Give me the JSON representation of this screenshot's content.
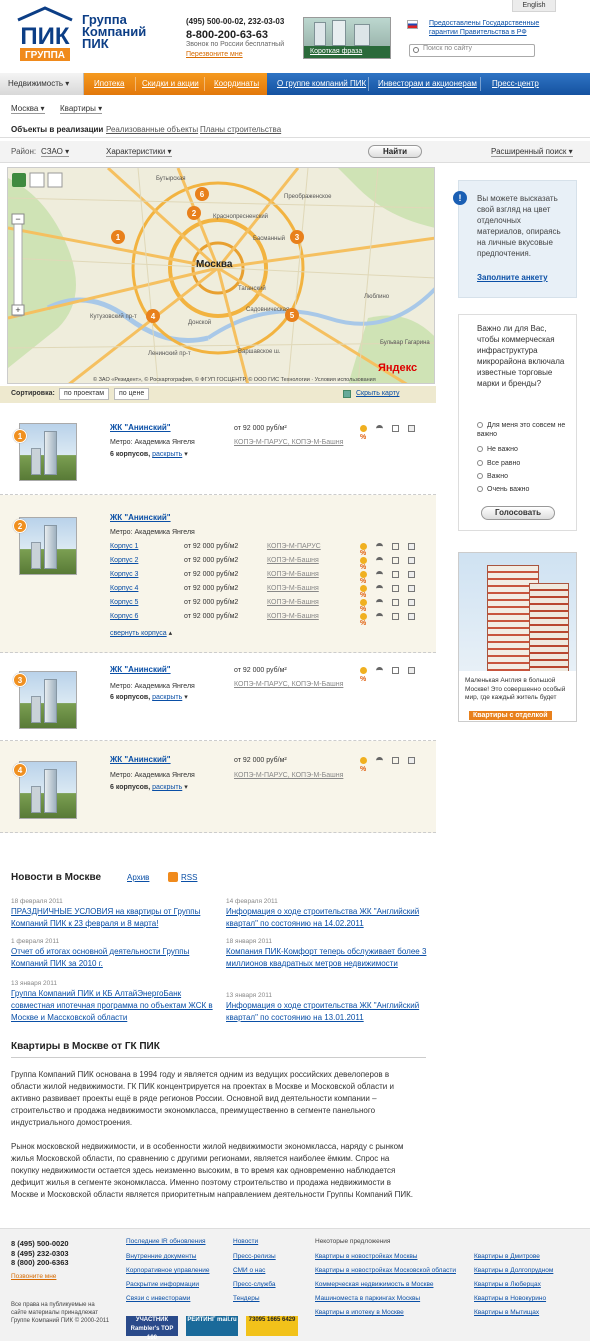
{
  "header": {
    "lang": "English",
    "logo_top": "ПИК",
    "logo_bottom": "ГРУППА",
    "brand": [
      "Группа",
      "Компаний",
      "ПИК"
    ],
    "phone_line": "(495) 500-00-02, 232-03-03",
    "phone_free": "8-800-200-63-63",
    "phone_free_note": "Звонок по России бесплатный",
    "callback": "Перезвоните мне",
    "promo_label": "Короткая фраза",
    "gos_link": "Предоставлены Государственные гарантии Правительства в РФ",
    "search_placeholder": "Поиск по сайту"
  },
  "nav": {
    "realty": "Недвижимость",
    "mortgage": "Ипотека",
    "discounts": "Скидки и акции",
    "coords": "Координаты",
    "about": "О группе компаний ПИК",
    "investors": "Инвесторам и акционерам",
    "press": "Пресс-центр"
  },
  "subnav": {
    "city": "Москва",
    "type": "Квартиры",
    "tab1": "Объекты в реализации",
    "tab2": "Реализованные объекты",
    "tab3": "Планы строительства",
    "district_label": "Район:",
    "district": "СЗАО",
    "characteristics": "Характеристики",
    "find": "Найти",
    "advanced": "Расширенный поиск"
  },
  "map": {
    "city_label": "Москва",
    "markers": [
      "1",
      "2",
      "3",
      "4",
      "5",
      "6"
    ],
    "copyright": "© ЗАО «Резидент», © Роскартография, © ФГУП ГОСЦЕНТР, © ООО ГИС Технологии · Условия использования",
    "yandex": "Яндекс",
    "streets": [
      "Бутырская",
      "Преображенское",
      "Краснопресненский",
      "Басманный",
      "Таганский",
      "Донской",
      "Люблино",
      "Бульвар Гагарина",
      "Садовническая",
      "Кутузовский пр-т",
      "Ленинский пр-т",
      "Варшавское ш."
    ]
  },
  "sortbar": {
    "label": "Сортировка:",
    "by_project": "по проектам",
    "by_price": "по цене",
    "hide_map": "Скрыть карту"
  },
  "objects": [
    {
      "num": "1",
      "title": "ЖК \"Анинский\"",
      "metro": "Метро: Академика Янгеля",
      "korpus": "6 корпусов,",
      "expand": "раскрыть",
      "price": "от 92 000 руб/м²",
      "dev": "КОПЭ-М-ПАРУС, КОПЭ-М-Башня"
    },
    {
      "num": "2",
      "title": "ЖК \"Анинский\"",
      "metro": "Метро: Академика Янгеля",
      "collapse": "свернуть корпуса",
      "rows": [
        {
          "name": "Корпус 1",
          "price": "от 92 000 руб/м2",
          "dev": "КОПЭ-М-ПАРУС"
        },
        {
          "name": "Корпус 2",
          "price": "от 92 000 руб/м2",
          "dev": "КОПЭ-М-Башня"
        },
        {
          "name": "Корпус 3",
          "price": "от 92 000 руб/м2",
          "dev": "КОПЭ-М-Башня"
        },
        {
          "name": "Корпус 4",
          "price": "от 92 000 руб/м2",
          "dev": "КОПЭ-М-Башня"
        },
        {
          "name": "Корпус 5",
          "price": "от 92 000 руб/м2",
          "dev": "КОПЭ-М-Башня"
        },
        {
          "name": "Корпус 6",
          "price": "от 92 000 руб/м2",
          "dev": "КОПЭ-М-Башня"
        }
      ]
    },
    {
      "num": "3",
      "title": "ЖК \"Анинский\"",
      "metro": "Метро: Академика Янгеля",
      "korpus": "6 корпусов,",
      "expand": "раскрыть",
      "price": "от 92 000 руб/м²",
      "dev": "КОПЭ-М-ПАРУС, КОПЭ-М-Башня"
    },
    {
      "num": "4",
      "title": "ЖК \"Анинский\"",
      "metro": "Метро: Академика Янгеля",
      "korpus": "6 корпусов,",
      "expand": "раскрыть",
      "price": "от 92 000 руб/м²",
      "dev": "КОПЭ-М-ПАРУС, КОПЭ-М-Башня"
    }
  ],
  "sidebar": {
    "info_text": "Вы можете высказать свой взгляд на цвет отделочных материалов, опираясь на личные вкусовые предпочтения.",
    "info_link": "Заполните анкету",
    "poll_q": "Важно ли для Вас, чтобы коммерческая инфраструктура микрорайона включала известные торговые марки и бренды?",
    "poll_opts": [
      "Для меня это совсем не важно",
      "Не важно",
      "Все равно",
      "Важно",
      "Очень важно"
    ],
    "vote": "Голосовать",
    "banner_text": "Маленькая Англия в большой Москве! Это совершенно особый мир, где каждый житель будет",
    "banner_btn": "Квартиры с отделкой"
  },
  "news": {
    "title": "Новости в Москве",
    "archive": "Архив",
    "rss": "RSS",
    "items": [
      {
        "date": "18 февраля 2011",
        "text": "ПРАЗДНИЧНЫЕ УСЛОВИЯ на квартиры от Группы Компаний ПИК к 23 февраля и 8 марта!"
      },
      {
        "date": "14 февраля 2011",
        "text": "Информация о ходе строительства ЖК \"Английский квартал\" по состоянию на 14.02.2011"
      },
      {
        "date": "1 февраля 2011",
        "text": "Отчет об итогах основной деятельности Группы Компаний ПИК за 2010 г."
      },
      {
        "date": "18 января 2011",
        "text": "Компания ПИК-Комфорт теперь обслуживает более 3 миллионов квадратных метров недвижимости"
      },
      {
        "date": "13 января 2011",
        "text": "Группа Компаний ПИК и КБ АлтайЭнергоБанк совместная ипотечная программа по объектам ЖСК в Москве и Массковской области"
      },
      {
        "date": "13 января 2011",
        "text": "Информация о ходе строительства ЖК \"Английский квартал\" по состоянию на 13.01.2011"
      }
    ]
  },
  "about": {
    "title": "Квартиры в Москве от ГК ПИК",
    "p1": "Группа Компаний ПИК основана в 1994 году и является одним из ведущих российских девелоперов в области жилой недвижимости. ГК ПИК концентрируется на проектах в Москве и Московской области и активно развивает проекты ещё в ряде регионов России. Основной вид деятельности компании – строительство и продажа недвижимости экономкласса, преимущественно в сегменте панельного индустриального домостроения.",
    "p2": "Рынок московской недвижимости, и в особенности жилой недвижимости экономкласса, наряду с рынком жилья Московской области, по сравнению с другими регионами, является наиболее ёмким. Спрос на покупку недвижимости остается здесь неизменно высоким, в то время как одновременно наблюдается дефицит жилья в сегменте экономкласса. Именно поэтому строительство и продажа недвижимости в Москве и Московской области является приоритетным направлением деятельности Группы Компаний ПИК."
  },
  "footer": {
    "phones": [
      "8 (495) 500-0020",
      "8 (495) 232-0303",
      "8 (800) 200-6363"
    ],
    "callback": "Позвоните мне",
    "copyright": "Все права на публикуемые на сайте материалы принадлежат Группе Компаний ПИК © 2000-2011",
    "col1": [
      "Последние IR обновления",
      "Внутренние документы",
      "Корпоративное управление",
      "Раскрытие информации",
      "Связи с инвесторами"
    ],
    "col2": [
      "Новости",
      "Пресс-релизы",
      "СМИ о нас",
      "Пресс-служба",
      "Тендеры"
    ],
    "offers_title": "Некоторые предложения",
    "col3": [
      "Квартиры в новостройках Москвы",
      "Квартиры в новостройках Московской области",
      "Коммерческая недвижимость в Москве",
      "Машиноместа в паркингах Москвы",
      "Квартиры в ипотеку в Москве"
    ],
    "col4": [
      "Квартиры в Дмитрове",
      "Квартиры в Долгопрудном",
      "Квартиры в Люберцах",
      "Квартиры в Новокурино",
      "Квартиры в Мытищах"
    ],
    "counters": [
      "УЧАСТНИК Rambler's TOP 100",
      "РЕЙТИНГ mail.ru",
      "73095 1665 6429"
    ]
  }
}
